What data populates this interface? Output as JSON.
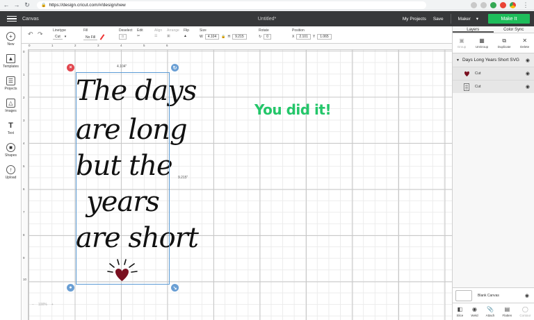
{
  "browser": {
    "url": "https://design.cricut.com/#/design/new"
  },
  "topbar": {
    "canvas_label": "Canvas",
    "title": "Untitled*",
    "my_projects": "My Projects",
    "save": "Save",
    "machine": "Maker",
    "make_button": "Make It"
  },
  "toolbar": {
    "linetype_label": "Linetype",
    "linetype_value": "Cut",
    "fill_label": "Fill",
    "fill_value": "No Fill",
    "deselect_label": "Deselect",
    "edit_label": "Edit",
    "align_label": "Align",
    "arrange_label": "Arrange",
    "flip_label": "Flip",
    "size_label": "Size",
    "w_label": "W",
    "w_value": "4.104",
    "h_label": "H",
    "h_value": "9.215",
    "rotate_label": "Rotate",
    "rotate_value": "0",
    "position_label": "Position",
    "x_label": "X",
    "x_value": "2.101",
    "y_label": "Y",
    "y_value": "1.065"
  },
  "sidebar": {
    "items": [
      {
        "label": "New",
        "icon": "plus-icon"
      },
      {
        "label": "Templates",
        "icon": "shirt-icon"
      },
      {
        "label": "Projects",
        "icon": "projects-icon"
      },
      {
        "label": "Images",
        "icon": "image-icon"
      },
      {
        "label": "Text",
        "icon": "text-icon"
      },
      {
        "label": "Shapes",
        "icon": "shapes-icon"
      },
      {
        "label": "Upload",
        "icon": "upload-icon"
      }
    ]
  },
  "panel": {
    "tabs": [
      "Layers",
      "Color Sync"
    ],
    "tools": [
      "Group",
      "UnGroup",
      "Duplicate",
      "Delete"
    ],
    "layer_group": "Days Long Years Short SVG",
    "layers": [
      "Cut",
      "Cut"
    ],
    "blank_canvas": "Blank Canvas",
    "bottom_tools": [
      "Slice",
      "Weld",
      "Attach",
      "Flatten",
      "Contour"
    ]
  },
  "canvas": {
    "ruler_ticks": [
      "0",
      "1",
      "2",
      "3",
      "4",
      "5",
      "6",
      "7",
      "8",
      "9",
      "10"
    ],
    "width_label": "4.104\"",
    "height_label": "9.215\"",
    "art_lines": [
      "The days",
      "are long",
      "but the",
      "years",
      "are short"
    ],
    "overlay_text": "You did it!",
    "zoom": "100%"
  },
  "colors": {
    "topbar": "#37383a",
    "make_button": "#1ebd5b",
    "overlay_text": "#24c66a",
    "heart": "#7a1020",
    "selection": "#5b9bd5"
  }
}
